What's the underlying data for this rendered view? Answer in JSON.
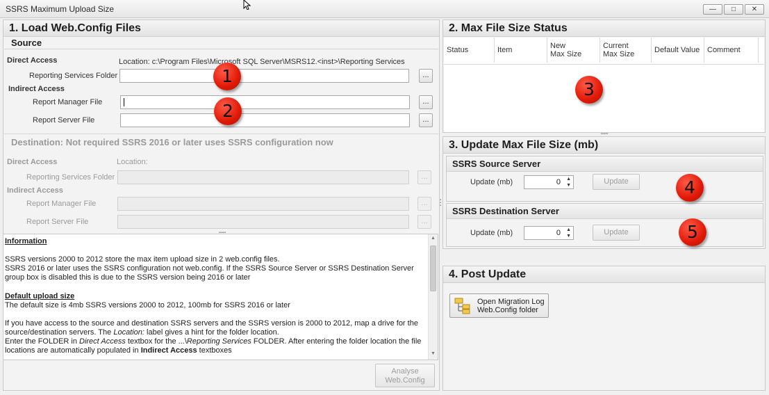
{
  "window": {
    "title": "SSRS Maximum Upload Size",
    "minimize_glyph": "—",
    "maximize_glyph": "□",
    "close_glyph": "✕"
  },
  "load_panel": {
    "title": "1. Load Web.Config Files",
    "source": {
      "header": "Source",
      "direct_access_label": "Direct Access",
      "location_label": "Location: c:\\Program Files\\Microsoft SQL Server\\MSRS12.<inst>\\Reporting Services",
      "reporting_services_folder_label": "Reporting Services Folder",
      "reporting_services_folder_value": "",
      "indirect_access_label": "Indirect Access",
      "report_manager_file_label": "Report Manager File",
      "report_manager_file_value": "",
      "report_server_file_label": "Report Server File",
      "report_server_file_value": ""
    },
    "destination": {
      "header": "Destination: Not required SSRS 2016 or later uses SSRS configuration now",
      "direct_access_label": "Direct Access",
      "location_label": "Location:",
      "reporting_services_folder_label": "Reporting Services Folder",
      "indirect_access_label": "Indirect Access",
      "report_manager_file_label": "Report Manager File",
      "report_server_file_label": "Report Server File"
    },
    "browse_label": "...",
    "information": {
      "heading": "Information",
      "para1": "SSRS versions 2000 to 2012 store the max item upload size in 2 web.config files.",
      "para2": "SSRS 2016 or later uses the SSRS configuration not web.config. If the SSRS Source Server or SSRS Destination Server group box is disabled this is due to the SSRS version being 2016 or later",
      "default_heading": "Default upload size",
      "para3": "The default size is 4mb SSRS versions 2000 to 2012, 100mb for SSRS 2016 or later",
      "para4": "If you have access to the source and destination SSRS servers and the SSRS version is 2000 to 2012, map a drive for the source/destination servers. The",
      "para4_em": "Location:",
      "para4_end": "label gives a hint for the folder location.",
      "para5_a": "Enter the FOLDER in",
      "para5_em1": "Direct Access",
      "para5_b": "textbox for the ...\\",
      "para5_em2": "Reporting Services",
      "para5_c": "FOLDER. After entering the folder location the file locations are automatically populated in",
      "para5_strong": "Indirect Access",
      "para5_d": "textboxes"
    },
    "analyse_button_line1": "Analyse",
    "analyse_button_line2": "Web.Config"
  },
  "status_panel": {
    "title": "2. Max File Size Status",
    "columns": [
      "Status",
      "Item",
      "New\nMax Size",
      "Current\nMax Size",
      "Default Value",
      "Comment"
    ]
  },
  "update_panel": {
    "title": "3. Update Max File Size (mb)",
    "source_server": {
      "header": "SSRS Source Server",
      "label": "Update (mb)",
      "value": "0",
      "button": "Update"
    },
    "destination_server": {
      "header": "SSRS Destination Server",
      "label": "Update (mb)",
      "value": "0",
      "button": "Update"
    }
  },
  "post_panel": {
    "title": "4. Post Update",
    "button_line1": "Open Migration Log",
    "button_line2": "Web.Config folder"
  },
  "badges": [
    "1",
    "2",
    "3",
    "4",
    "5"
  ],
  "colors": {
    "badge_red": "#e01906",
    "panel_border": "#c9c9c9",
    "disabled_text": "#9a9a9a"
  }
}
